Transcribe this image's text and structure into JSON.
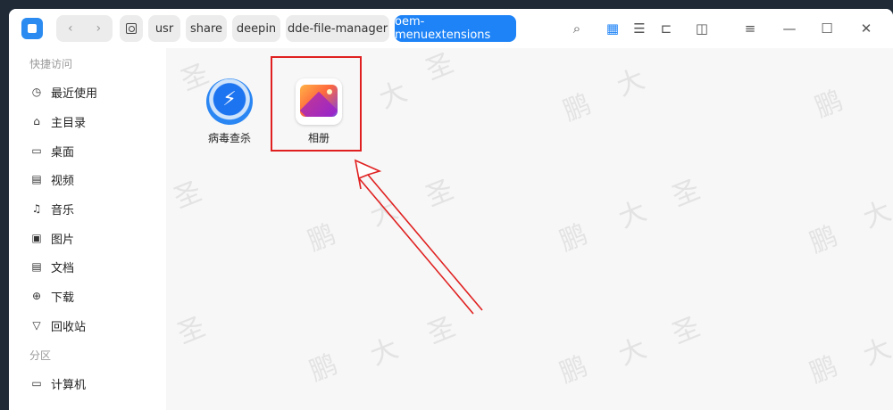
{
  "toolbar": {
    "back_glyph": "‹",
    "forward_glyph": "›"
  },
  "breadcrumb": [
    {
      "label": "usr"
    },
    {
      "label": "share"
    },
    {
      "label": "deepin"
    },
    {
      "label": "dde-file-manager"
    },
    {
      "label": "oem-menuextensions"
    }
  ],
  "toolbar_icons": {
    "search": "⌕",
    "icon_view": "▦",
    "list_view": "☰",
    "tree_view": "⊏",
    "details": "◫",
    "menu": "≡",
    "minimize": "—",
    "maximize": "☐",
    "close": "✕"
  },
  "sidebar": {
    "quick_access_header": "快捷访问",
    "items": [
      {
        "label": "最近使用",
        "icon": "clock-icon",
        "glyph": "◷"
      },
      {
        "label": "主目录",
        "icon": "home-icon",
        "glyph": "⌂"
      },
      {
        "label": "桌面",
        "icon": "desktop-icon",
        "glyph": "▭"
      },
      {
        "label": "视频",
        "icon": "video-icon",
        "glyph": "▤"
      },
      {
        "label": "音乐",
        "icon": "music-icon",
        "glyph": "♫"
      },
      {
        "label": "图片",
        "icon": "picture-icon",
        "glyph": "▣"
      },
      {
        "label": "文档",
        "icon": "document-icon",
        "glyph": "▤"
      },
      {
        "label": "下载",
        "icon": "download-icon",
        "glyph": "⊕"
      },
      {
        "label": "回收站",
        "icon": "trash-icon",
        "glyph": "▽"
      }
    ],
    "partition_header": "分区",
    "partition_items": [
      {
        "label": "计算机",
        "icon": "computer-icon",
        "glyph": "▭"
      }
    ]
  },
  "files": [
    {
      "label": "病毒查杀",
      "icon": "antivirus-shield-icon"
    },
    {
      "label": "相册",
      "icon": "album-icon"
    }
  ],
  "watermark_chars": [
    "大",
    "圣",
    "鹏"
  ],
  "colors": {
    "accent": "#1e83f6",
    "highlight": "#e02020"
  }
}
